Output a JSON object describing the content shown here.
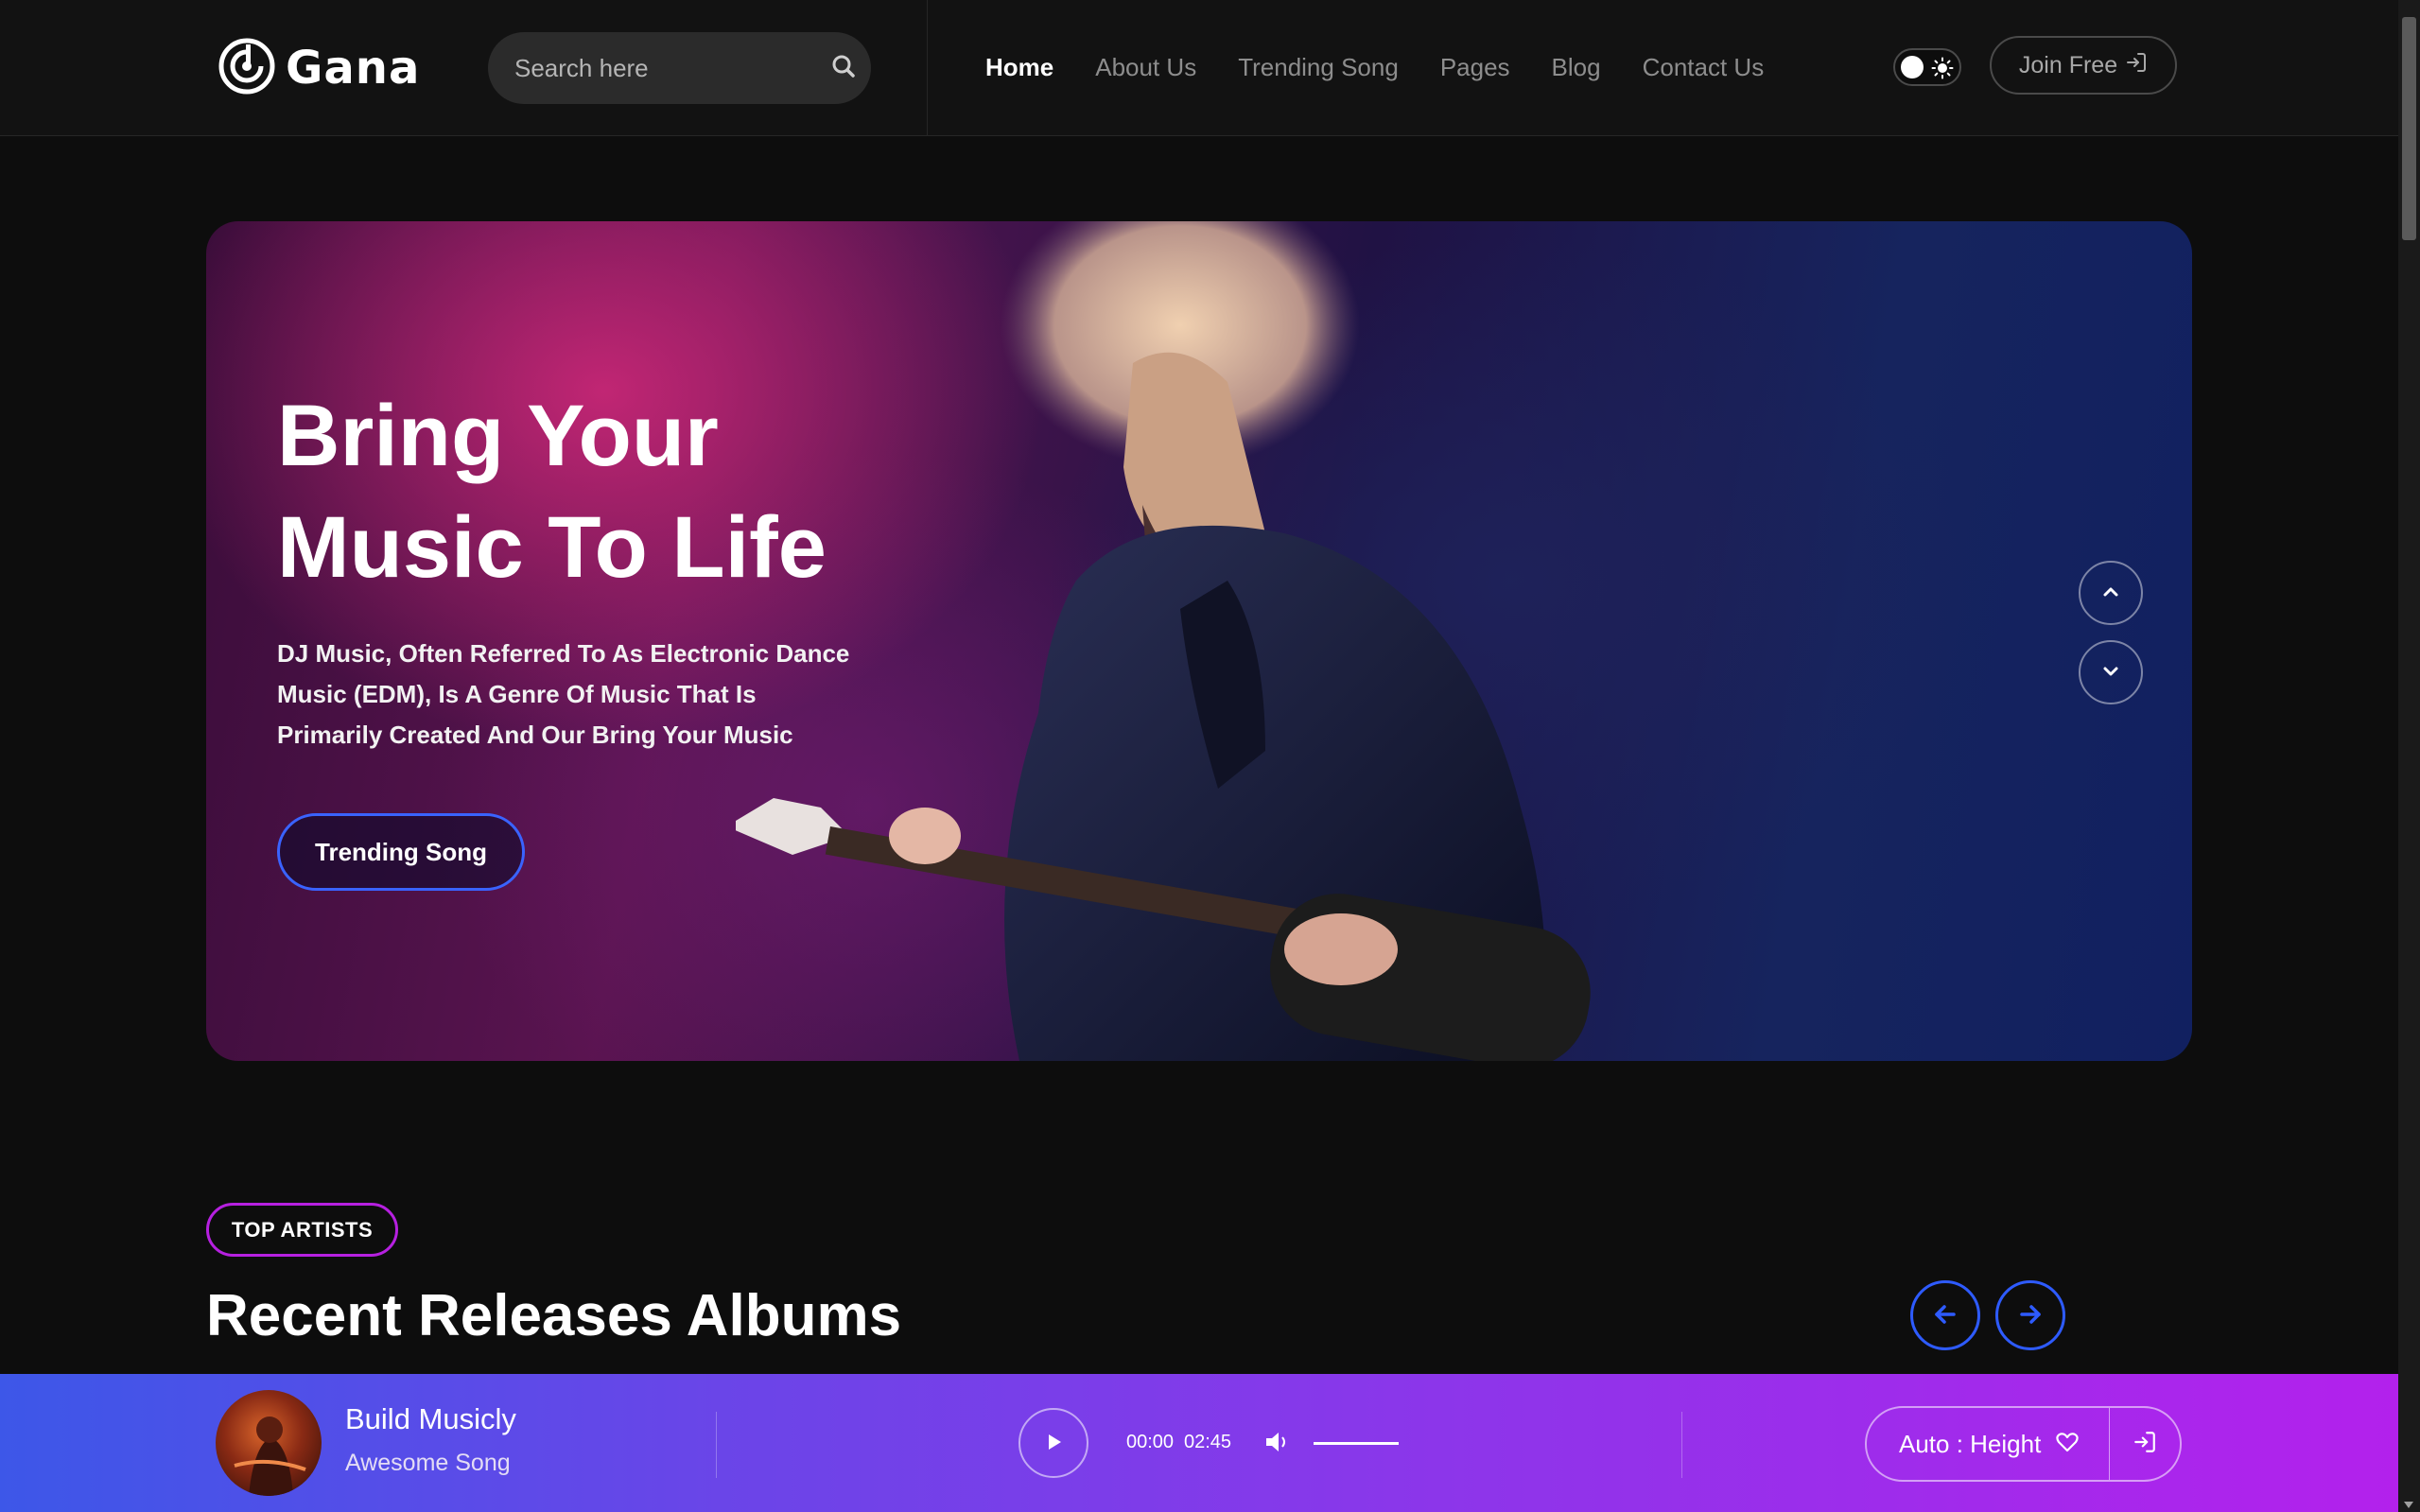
{
  "header": {
    "logo_text": "Gana",
    "search": {
      "placeholder": "Search here",
      "icon": "search-icon"
    },
    "nav": [
      {
        "label": "Home",
        "active": true
      },
      {
        "label": "About Us",
        "active": false
      },
      {
        "label": "Trending Song",
        "active": false
      },
      {
        "label": "Pages",
        "active": false
      },
      {
        "label": "Blog",
        "active": false
      },
      {
        "label": "Contact Us",
        "active": false
      }
    ],
    "theme_toggle": {
      "icon": "sun-icon",
      "state": "dark"
    },
    "join_label": "Join Free",
    "join_icon": "login-icon"
  },
  "hero": {
    "title_line1": "Bring Your",
    "title_line2": "Music To Life",
    "description": "DJ Music, Often Referred To As Electronic Dance Music (EDM), Is A Genre Of Music That Is Primarily Created And Our Bring Your Music",
    "cta_label": "Trending Song",
    "arrow_up_icon": "chevron-up-icon",
    "arrow_down_icon": "chevron-down-icon"
  },
  "section": {
    "badge": "TOP ARTISTS",
    "title": "Recent Releases Albums",
    "prev_icon": "arrow-left-icon",
    "next_icon": "arrow-right-icon"
  },
  "player": {
    "title": "Build Musicly",
    "subtitle": "Awesome Song",
    "current_time": "00:00",
    "duration": "02:45",
    "volume": 1.0,
    "auto_height_label": "Auto : Height",
    "icons": [
      "play-icon",
      "volume-icon",
      "heart-icon",
      "login-icon"
    ]
  },
  "colors": {
    "background": "#0d0d0d",
    "header": "#121212",
    "accent_blue": "#2e5bff",
    "accent_purple": "#b620e0",
    "player_gradient_start": "#3d57e8",
    "player_gradient_end": "#b321ec"
  }
}
